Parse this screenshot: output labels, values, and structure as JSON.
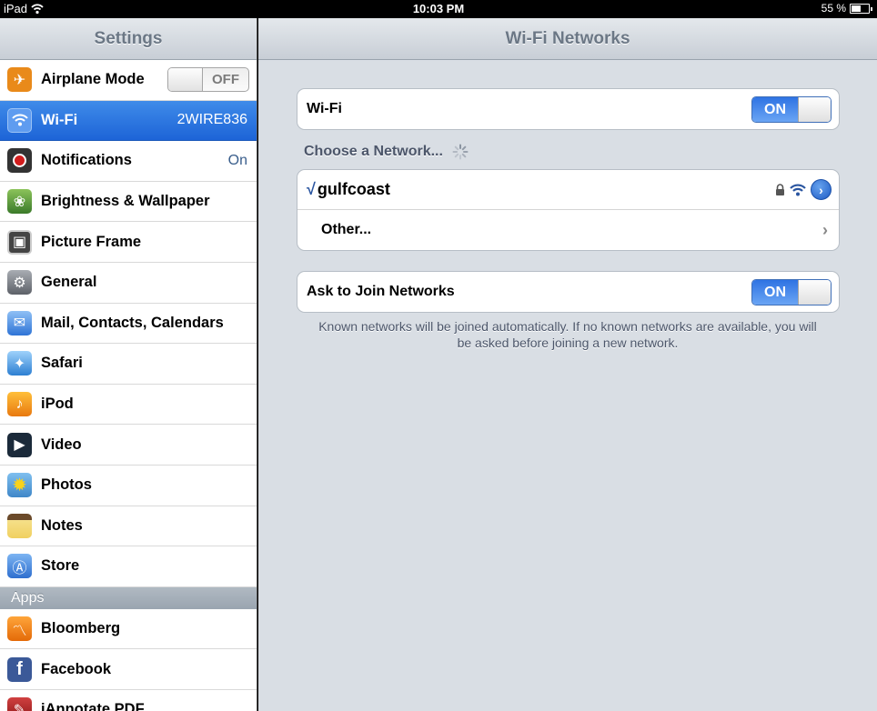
{
  "statusbar": {
    "device": "iPad",
    "time": "10:03 PM",
    "battery_pct_text": "55 %",
    "battery_level": 0.55
  },
  "master": {
    "title": "Settings",
    "items": [
      {
        "label": "Airplane Mode",
        "toggle": "OFF",
        "icon": "airplane-icon",
        "color": "#e98a1a"
      },
      {
        "label": "Wi-Fi",
        "value": "2WIRE836",
        "icon": "wifi-icon",
        "color": "#3a7be0",
        "selected": true
      },
      {
        "label": "Notifications",
        "value": "On",
        "icon": "notifications-icon",
        "color": "#d21d1d"
      },
      {
        "label": "Brightness & Wallpaper",
        "icon": "brightness-wallpaper-icon",
        "color": "#5a9a3a"
      },
      {
        "label": "Picture Frame",
        "icon": "picture-frame-icon",
        "color": "#555555"
      },
      {
        "label": "General",
        "icon": "gear-icon",
        "color": "#7b7f85"
      },
      {
        "label": "Mail, Contacts, Calendars",
        "icon": "mail-icon",
        "color": "#4a8fe0"
      },
      {
        "label": "Safari",
        "icon": "safari-icon",
        "color": "#3a8ed6"
      },
      {
        "label": "iPod",
        "icon": "ipod-icon",
        "color": "#f08a17"
      },
      {
        "label": "Video",
        "icon": "video-icon",
        "color": "#222222"
      },
      {
        "label": "Photos",
        "icon": "photos-icon",
        "color": "#f3c418"
      },
      {
        "label": "Notes",
        "icon": "notes-icon",
        "color": "#e8c74e"
      },
      {
        "label": "Store",
        "icon": "store-icon",
        "color": "#3e7ed9"
      }
    ],
    "apps_section": "Apps",
    "apps": [
      {
        "label": "Bloomberg",
        "icon": "bloomberg-icon",
        "color": "#f07d10"
      },
      {
        "label": "Facebook",
        "icon": "facebook-icon",
        "color": "#3b5998"
      },
      {
        "label": "iAnnotate PDF",
        "icon": "iannotate-icon",
        "color": "#a32222"
      }
    ]
  },
  "detail": {
    "title": "Wi-Fi Networks",
    "wifi_label": "Wi-Fi",
    "wifi_toggle": "ON",
    "choose_label": "Choose a Network...",
    "networks": [
      {
        "check": "√",
        "name": "gulfcoast"
      }
    ],
    "other_label": "Other...",
    "ask_label": "Ask to Join Networks",
    "ask_toggle": "ON",
    "footnote": "Known networks will be joined automatically.  If no known networks are available, you will be asked before joining a new network."
  }
}
